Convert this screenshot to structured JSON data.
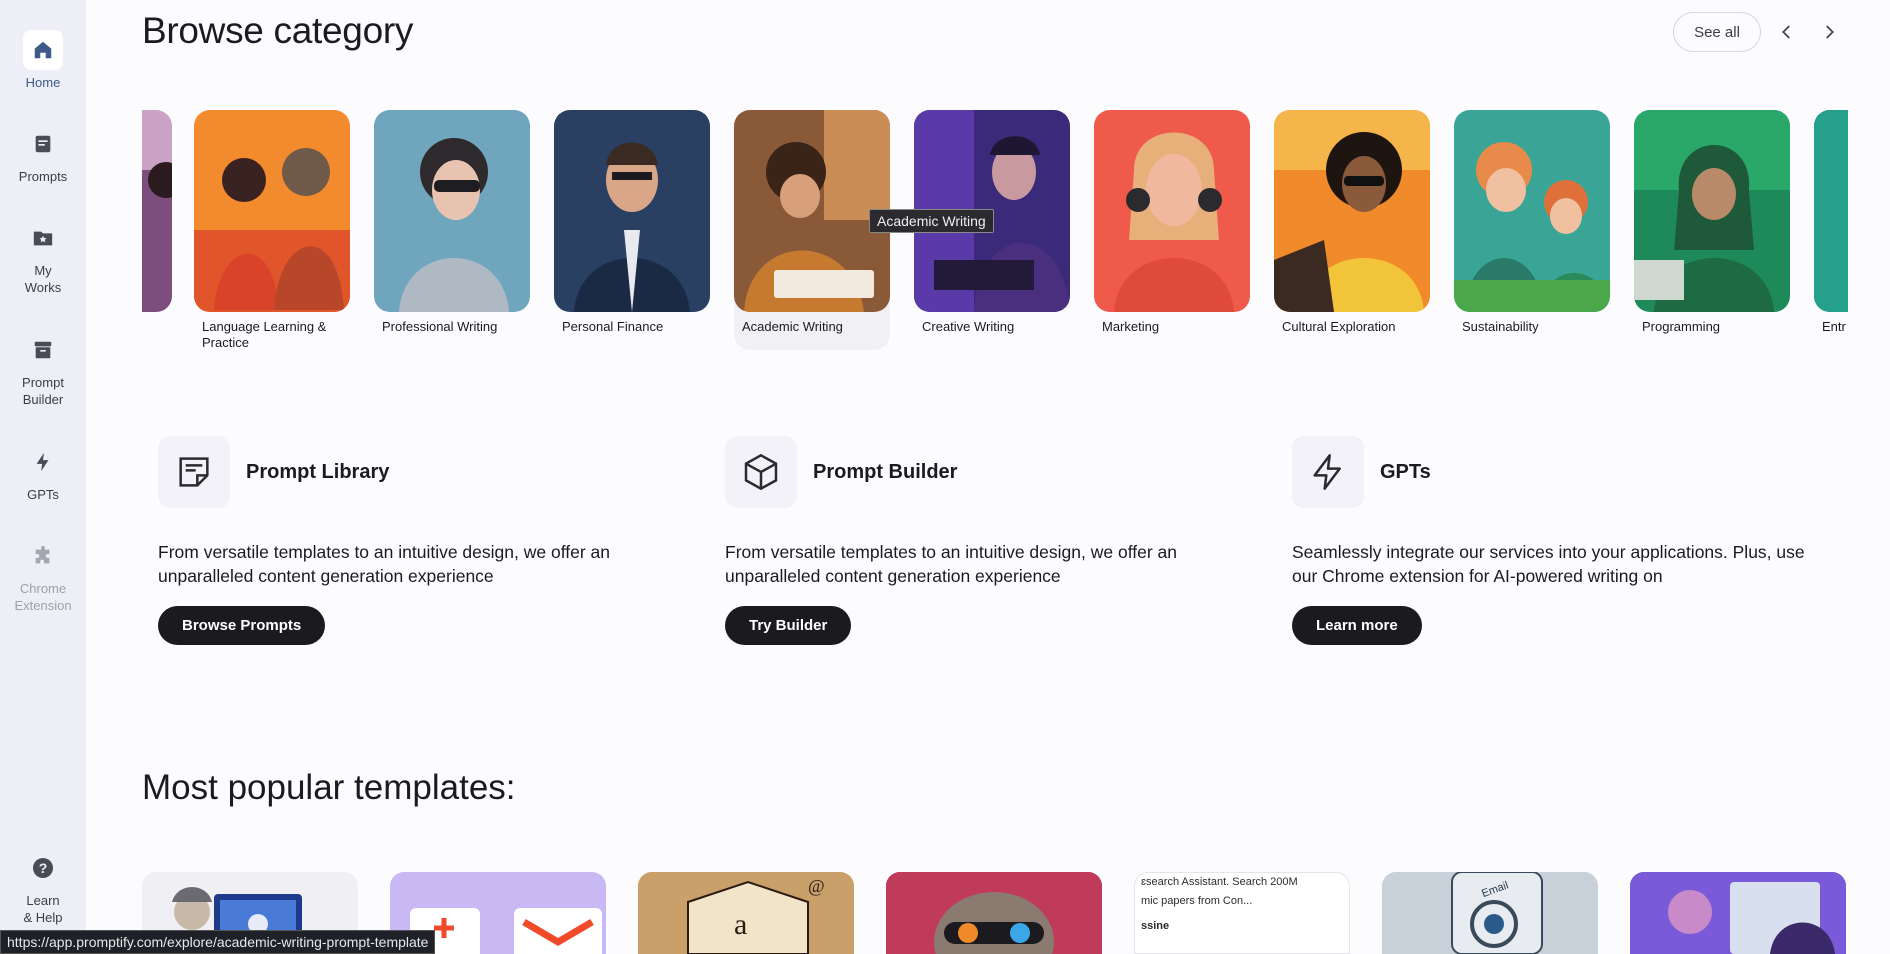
{
  "sidebar": {
    "items": [
      {
        "label": "Home",
        "icon": "home-icon"
      },
      {
        "label": "Prompts",
        "icon": "prompts-icon"
      },
      {
        "label": "My\nWorks",
        "icon": "folder-star-icon"
      },
      {
        "label": "Prompt\nBuilder",
        "icon": "archive-icon"
      },
      {
        "label": "GPTs",
        "icon": "bolt-icon"
      },
      {
        "label": "Chrome\nExtension",
        "icon": "puzzle-icon"
      },
      {
        "label": "Learn\n& Help",
        "icon": "help-icon"
      }
    ]
  },
  "browse": {
    "title": "Browse category",
    "see_all": "See all",
    "categories": [
      {
        "label": ""
      },
      {
        "label": "Language Learning & Practice"
      },
      {
        "label": "Professional Writing"
      },
      {
        "label": "Personal Finance"
      },
      {
        "label": "Academic Writing"
      },
      {
        "label": "Creative Writing"
      },
      {
        "label": "Marketing"
      },
      {
        "label": "Cultural Exploration"
      },
      {
        "label": "Sustainability"
      },
      {
        "label": "Programming"
      },
      {
        "label": "Entr"
      }
    ],
    "tooltip": "Academic Writing"
  },
  "features": [
    {
      "title": "Prompt Library",
      "desc": "From versatile templates to an intuitive design, we offer an unparalleled content generation experience",
      "button": "Browse Prompts",
      "icon": "note-icon"
    },
    {
      "title": "Prompt Builder",
      "desc": "From versatile templates to an intuitive design, we offer an unparalleled content generation experience",
      "button": "Try Builder",
      "icon": "cube-icon"
    },
    {
      "title": "GPTs",
      "desc": "Seamlessly integrate our services into your applications. Plus, use our Chrome extension for AI-powered writing on",
      "button": "Learn more",
      "icon": "bolt-icon"
    }
  ],
  "popular": {
    "title": "Most popular templates:",
    "research_card_lines": [
      "ɛsearch Assistant. Search 200M",
      "mic papers from Con...",
      "ssine"
    ]
  },
  "status_url": "https://app.promptify.com/explore/academic-writing-prompt-template",
  "colors": {
    "accent": "#3d5a8a",
    "sidebar_bg": "#eeeff6",
    "button_dark": "#1b1b1f"
  }
}
